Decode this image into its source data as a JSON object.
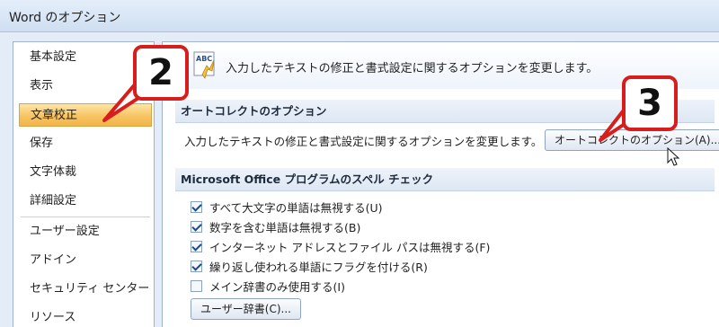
{
  "window": {
    "title": "Word のオプション"
  },
  "sidebar": {
    "items": [
      {
        "label": "基本設定",
        "selected": false
      },
      {
        "label": "表示",
        "selected": false
      },
      {
        "label": "文章校正",
        "selected": true
      },
      {
        "label": "保存",
        "selected": false
      },
      {
        "label": "文字体裁",
        "selected": false
      },
      {
        "label": "詳細設定",
        "selected": false
      },
      {
        "label": "ユーザー設定",
        "selected": false
      },
      {
        "label": "アドイン",
        "selected": false
      },
      {
        "label": "セキュリティ センター",
        "selected": false
      },
      {
        "label": "リソース",
        "selected": false
      }
    ]
  },
  "main": {
    "intro_text": "入力したテキストの修正と書式設定に関するオプションを変更します。",
    "autocorrect_section": {
      "header": "オートコレクトのオプション",
      "description": "入力したテキストの修正と書式設定に関するオプションを変更します。",
      "button_label": "オートコレクトのオプション(A)..."
    },
    "spelling_section": {
      "header": "Microsoft Office プログラムのスペル チェック",
      "options": [
        {
          "label": "すべて大文字の単語は無視する(U)",
          "checked": true
        },
        {
          "label": "数字を含む単語は無視する(B)",
          "checked": true
        },
        {
          "label": "インターネット アドレスとファイル パスは無視する(F)",
          "checked": true
        },
        {
          "label": "繰り返し使われる単語にフラグを付ける(R)",
          "checked": true
        },
        {
          "label": "メイン辞書のみ使用する(I)",
          "checked": false
        }
      ],
      "dictionary_button_label": "ユーザー辞書(C)..."
    }
  },
  "callouts": [
    {
      "number": "2",
      "target": "sidebar.items.2"
    },
    {
      "number": "3",
      "target": "main.autocorrect_section.button"
    }
  ],
  "icons": {
    "abc_check": "abc-spelling-icon",
    "cursor": "mouse-pointer-icon"
  },
  "colors": {
    "selected_item": "#f7c463",
    "callout_border": "#d81d1d"
  }
}
